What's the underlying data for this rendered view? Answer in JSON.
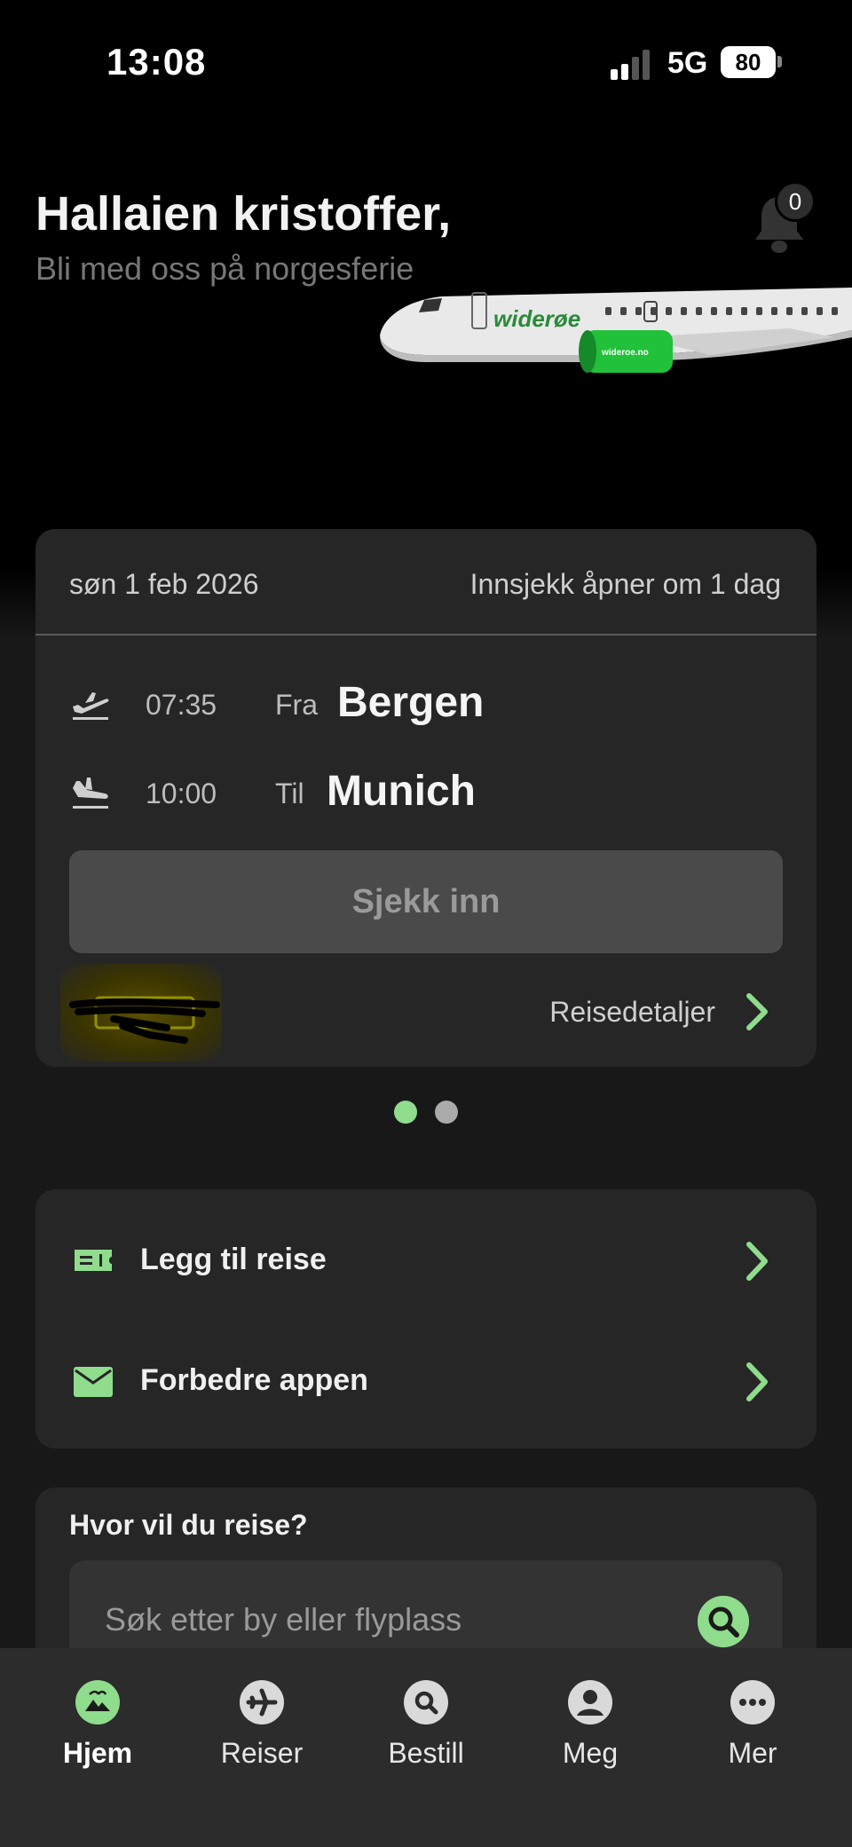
{
  "status_bar": {
    "time": "13:08",
    "network": "5G",
    "battery": "80"
  },
  "header": {
    "greeting": "Hallaien kristoffer,",
    "subtitle": "Bli med oss på norgesferie",
    "notification_count": "0"
  },
  "plane": {
    "brand": "widerøe",
    "engine_text": "wideroe.no"
  },
  "flight_card": {
    "date": "søn 1 feb 2026",
    "checkin_info": "Innsjekk åpner om 1 dag",
    "departure": {
      "time": "07:35",
      "direction": "Fra",
      "city": "Bergen"
    },
    "arrival": {
      "time": "10:00",
      "direction": "Til",
      "city": "Munich"
    },
    "checkin_button": "Sjekk inn",
    "details_link": "Reisedetaljer"
  },
  "pager": {
    "pages": 2,
    "active": 1
  },
  "actions": [
    {
      "label": "Legg til reise",
      "icon": "ticket-icon"
    },
    {
      "label": "Forbedre appen",
      "icon": "mail-icon"
    }
  ],
  "search": {
    "title": "Hvor vil du reise?",
    "placeholder": "Søk etter by eller flyplass"
  },
  "tabs": [
    {
      "label": "Hjem",
      "icon": "home-icon",
      "active": true
    },
    {
      "label": "Reiser",
      "icon": "plane-icon",
      "active": false
    },
    {
      "label": "Bestill",
      "icon": "search-icon",
      "active": false
    },
    {
      "label": "Meg",
      "icon": "user-icon",
      "active": false
    },
    {
      "label": "Mer",
      "icon": "more-icon",
      "active": false
    }
  ],
  "colors": {
    "accent": "#8fdc8c",
    "card": "#262626",
    "tabbar": "#2c2c2c"
  }
}
